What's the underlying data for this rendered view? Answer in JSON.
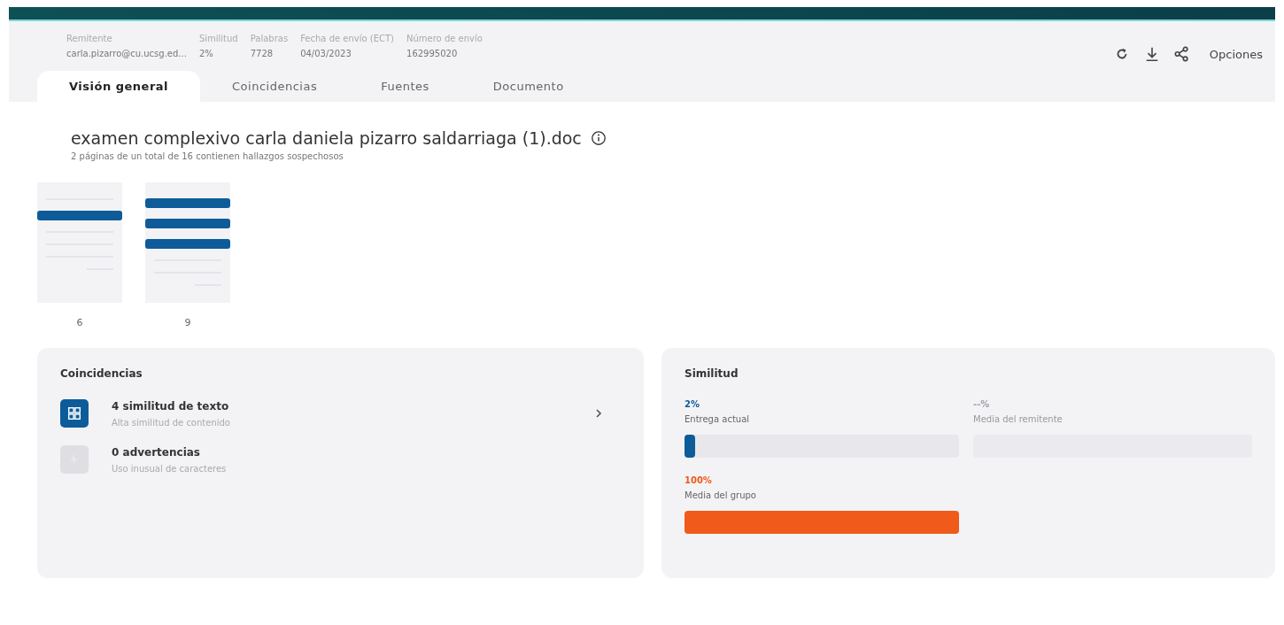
{
  "meta": [
    {
      "label": "Remitente",
      "value": "carla.pizarro@cu.ucsg.ed..."
    },
    {
      "label": "Similitud",
      "value": "2%"
    },
    {
      "label": "Palabras",
      "value": "7728"
    },
    {
      "label": "Fecha de envío (ECT)",
      "value": "04/03/2023"
    },
    {
      "label": "Número de envío",
      "value": "162995020"
    }
  ],
  "actions": {
    "options_label": "Opciones"
  },
  "tabs": [
    {
      "label": "Visión general",
      "selected": true
    },
    {
      "label": "Coincidencias",
      "selected": false
    },
    {
      "label": "Fuentes",
      "selected": false
    },
    {
      "label": "Documento",
      "selected": false
    }
  ],
  "document": {
    "title": "examen complexivo carla daniela pizarro saldarriaga (1).doc",
    "subtitle": "2 páginas de un total de 16 contienen hallazgos sospechosos"
  },
  "pages": [
    {
      "number": "6",
      "lines": [
        {
          "kind": "plain"
        },
        {
          "kind": "highlight"
        },
        {
          "kind": "plain"
        },
        {
          "kind": "plain"
        },
        {
          "kind": "plain"
        },
        {
          "kind": "short"
        }
      ]
    },
    {
      "number": "9",
      "lines": [
        {
          "kind": "highlight"
        },
        {
          "kind": "highlight"
        },
        {
          "kind": "highlight"
        },
        {
          "kind": "plain"
        },
        {
          "kind": "plain"
        },
        {
          "kind": "short"
        }
      ]
    }
  ],
  "matches": {
    "title": "Coincidencias",
    "items": [
      {
        "kind": "similarity",
        "title": "4 similitud de texto",
        "subtitle": "Alta similitud de contenido",
        "disabled": false
      },
      {
        "kind": "warning",
        "title": "0 advertencias",
        "subtitle": "Uso inusual de caracteres",
        "disabled": true
      }
    ]
  },
  "similarity": {
    "title": "Similitud",
    "bars": [
      {
        "reading": "2%",
        "label": "Entrega actual",
        "level": 0.02,
        "color": "#0d5c99",
        "disabled": false
      },
      {
        "reading": "--%",
        "label": "Media del remitente",
        "disabled": true
      },
      {
        "reading": "100%",
        "label": "Media del grupo",
        "level": 1,
        "color": "#f05a1a",
        "disabled": false
      }
    ]
  }
}
